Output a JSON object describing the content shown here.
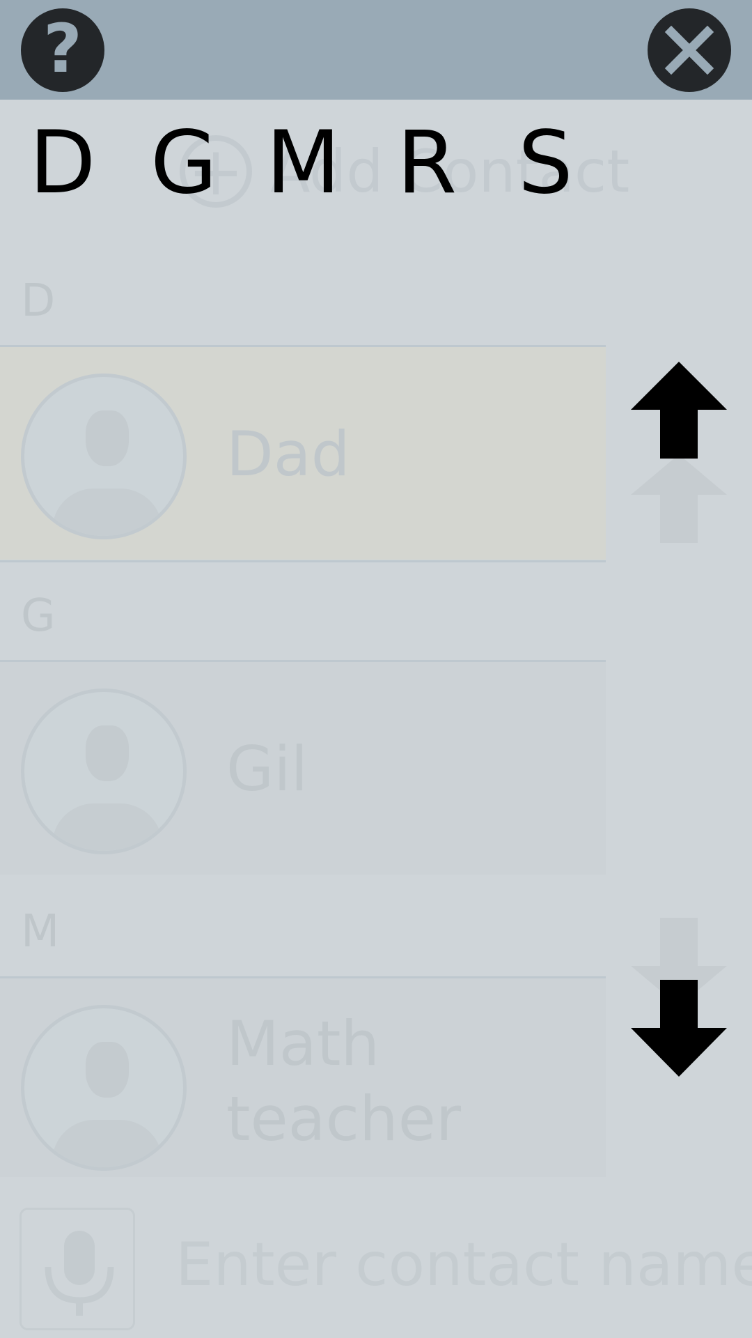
{
  "topbar": {
    "help_icon": "question-mark-icon",
    "close_icon": "close-x-icon",
    "help_label": "?"
  },
  "alphabet_index": [
    "D",
    "G",
    "M",
    "R",
    "S"
  ],
  "background_list": {
    "add_contact": {
      "icon": "plus-circle-icon",
      "label": "Add Contact"
    },
    "sections": [
      {
        "letter": "D",
        "contacts": [
          {
            "name": "Dad"
          }
        ]
      },
      {
        "letter": "G",
        "contacts": [
          {
            "name": "Gil"
          }
        ]
      },
      {
        "letter": "M",
        "contacts": [
          {
            "name": "Math teacher"
          }
        ]
      }
    ],
    "search": {
      "icon": "microphone-icon",
      "placeholder": "Enter contact name"
    }
  },
  "scroll": {
    "up_icon": "arrow-up-icon",
    "down_icon": "arrow-down-icon"
  },
  "colors": {
    "topbar": "#99aab6",
    "background": "#cfd5d9",
    "button_dark": "#232629",
    "highlight_row": "#d4d6d0"
  }
}
